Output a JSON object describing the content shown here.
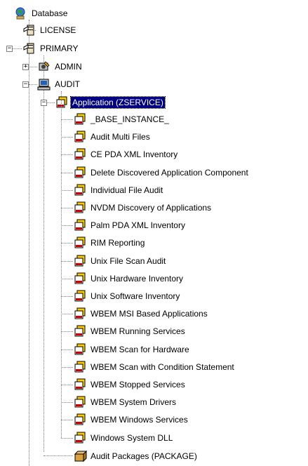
{
  "tree": {
    "root": {
      "label": "Database",
      "icon": "globe-database-icon"
    },
    "license": {
      "label": "LICENSE",
      "icon": "file-cabinet-icon"
    },
    "primary": {
      "label": "PRIMARY",
      "icon": "file-cabinet-icon",
      "expander": "−"
    },
    "admin": {
      "label": "ADMIN",
      "icon": "admin-tools-icon",
      "expander": "+"
    },
    "audit": {
      "label": "AUDIT",
      "icon": "audit-computer-icon",
      "expander": "−"
    },
    "application": {
      "label": "Application (ZSERVICE)",
      "icon": "application-instance-icon",
      "expander": "−",
      "selected": true
    },
    "instances": [
      "_BASE_INSTANCE_",
      "Audit Multi Files",
      "CE PDA XML Inventory",
      "Delete Discovered Application Component",
      "Individual File Audit",
      "NVDM Discovery of Applications",
      "Palm PDA XML Inventory",
      "RIM Reporting",
      "Unix File Scan Audit",
      "Unix Hardware Inventory",
      "Unix Software Inventory",
      "WBEM MSI Based Applications",
      "WBEM Running Services",
      "WBEM Scan for Hardware",
      "WBEM Scan with Condition Statement",
      "WBEM Stopped Services",
      "WBEM System Drivers",
      "WBEM Windows Services",
      "Windows System DLL"
    ],
    "audit_packages": {
      "label": "Audit Packages (PACKAGE)",
      "icon": "package-icon"
    }
  },
  "colors": {
    "selection": "#000080",
    "tree_line": "#808080",
    "instance_red": "#cc0000",
    "instance_yellow": "#ffcc00"
  }
}
